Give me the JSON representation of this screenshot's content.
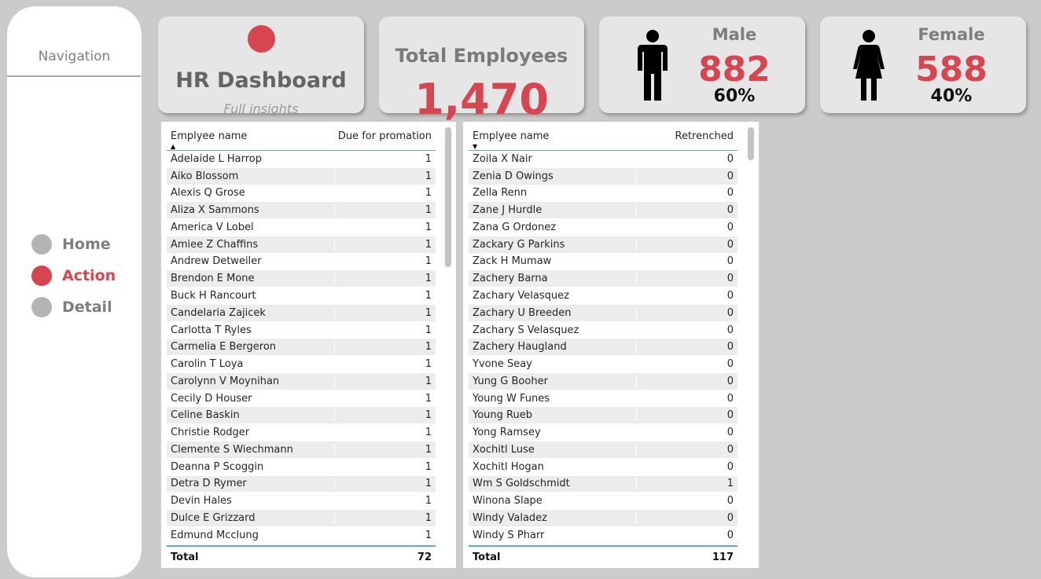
{
  "nav": {
    "title": "Navigation",
    "items": [
      {
        "label": "Home",
        "active": false
      },
      {
        "label": "Action",
        "active": true
      },
      {
        "label": "Detail",
        "active": false
      }
    ]
  },
  "hr_card": {
    "title": "HR Dashboard",
    "subtitle": "Full insights"
  },
  "total_card": {
    "title": "Total Employees",
    "value": "1,470"
  },
  "male_card": {
    "label": "Male",
    "value": "882",
    "percent": "60%",
    "icon": "male-person-icon"
  },
  "female_card": {
    "label": "Female",
    "value": "588",
    "percent": "40%",
    "icon": "female-person-icon"
  },
  "colors": {
    "accent": "#d64550",
    "card_bg": "#e6e6e6",
    "page_bg": "#cbcbcb",
    "header_rule": "#6aa3c9"
  },
  "promotion_table": {
    "name_header": "Emplyee name",
    "value_header": "Due for promation",
    "sort": "ascending",
    "rows": [
      {
        "name": "Adelaide L Harrop",
        "value": "1"
      },
      {
        "name": "Aiko Blossom",
        "value": "1"
      },
      {
        "name": "Alexis Q Grose",
        "value": "1"
      },
      {
        "name": "Aliza X Sammons",
        "value": "1"
      },
      {
        "name": "America V Lobel",
        "value": "1"
      },
      {
        "name": "Amiee Z Chaffins",
        "value": "1"
      },
      {
        "name": "Andrew Detweiler",
        "value": "1"
      },
      {
        "name": "Brendon E Mone",
        "value": "1"
      },
      {
        "name": "Buck H Rancourt",
        "value": "1"
      },
      {
        "name": "Candelaria Zajicek",
        "value": "1"
      },
      {
        "name": "Carlotta T Ryles",
        "value": "1"
      },
      {
        "name": "Carmelia E Bergeron",
        "value": "1"
      },
      {
        "name": "Carolin T Loya",
        "value": "1"
      },
      {
        "name": "Carolynn V Moynihan",
        "value": "1"
      },
      {
        "name": "Cecily D Houser",
        "value": "1"
      },
      {
        "name": "Celine Baskin",
        "value": "1"
      },
      {
        "name": "Christie Rodger",
        "value": "1"
      },
      {
        "name": "Clemente S Wiechmann",
        "value": "1"
      },
      {
        "name": "Deanna P Scoggin",
        "value": "1"
      },
      {
        "name": "Detra D Rymer",
        "value": "1"
      },
      {
        "name": "Devin Hales",
        "value": "1"
      },
      {
        "name": "Dulce E Grizzard",
        "value": "1"
      },
      {
        "name": "Edmund Mcclung",
        "value": "1"
      }
    ],
    "total_label": "Total",
    "total_value": "72"
  },
  "retrenched_table": {
    "name_header": "Emplyee name",
    "value_header": "Retrenched",
    "sort": "descending",
    "rows": [
      {
        "name": "Zoila X Nair",
        "value": "0"
      },
      {
        "name": "Zenia D Owings",
        "value": "0"
      },
      {
        "name": "Zella Renn",
        "value": "0"
      },
      {
        "name": "Zane J Hurdle",
        "value": "0"
      },
      {
        "name": "Zana G Ordonez",
        "value": "0"
      },
      {
        "name": "Zackary G Parkins",
        "value": "0"
      },
      {
        "name": "Zack H Mumaw",
        "value": "0"
      },
      {
        "name": "Zachery Barna",
        "value": "0"
      },
      {
        "name": "Zachary Velasquez",
        "value": "0"
      },
      {
        "name": "Zachary U Breeden",
        "value": "0"
      },
      {
        "name": "Zachary S Velasquez",
        "value": "0"
      },
      {
        "name": "Zachery Haugland",
        "value": "0"
      },
      {
        "name": "Yvone Seay",
        "value": "0"
      },
      {
        "name": "Yung G Booher",
        "value": "0"
      },
      {
        "name": "Young W Funes",
        "value": "0"
      },
      {
        "name": "Young Rueb",
        "value": "0"
      },
      {
        "name": "Yong Ramsey",
        "value": "0"
      },
      {
        "name": "Xochitl Luse",
        "value": "0"
      },
      {
        "name": "Xochitl Hogan",
        "value": "0"
      },
      {
        "name": "Wm S Goldschmidt",
        "value": "1"
      },
      {
        "name": "Winona Slape",
        "value": "0"
      },
      {
        "name": "Windy Valadez",
        "value": "0"
      },
      {
        "name": "Windy S Pharr",
        "value": "0"
      }
    ],
    "total_label": "Total",
    "total_value": "117"
  }
}
